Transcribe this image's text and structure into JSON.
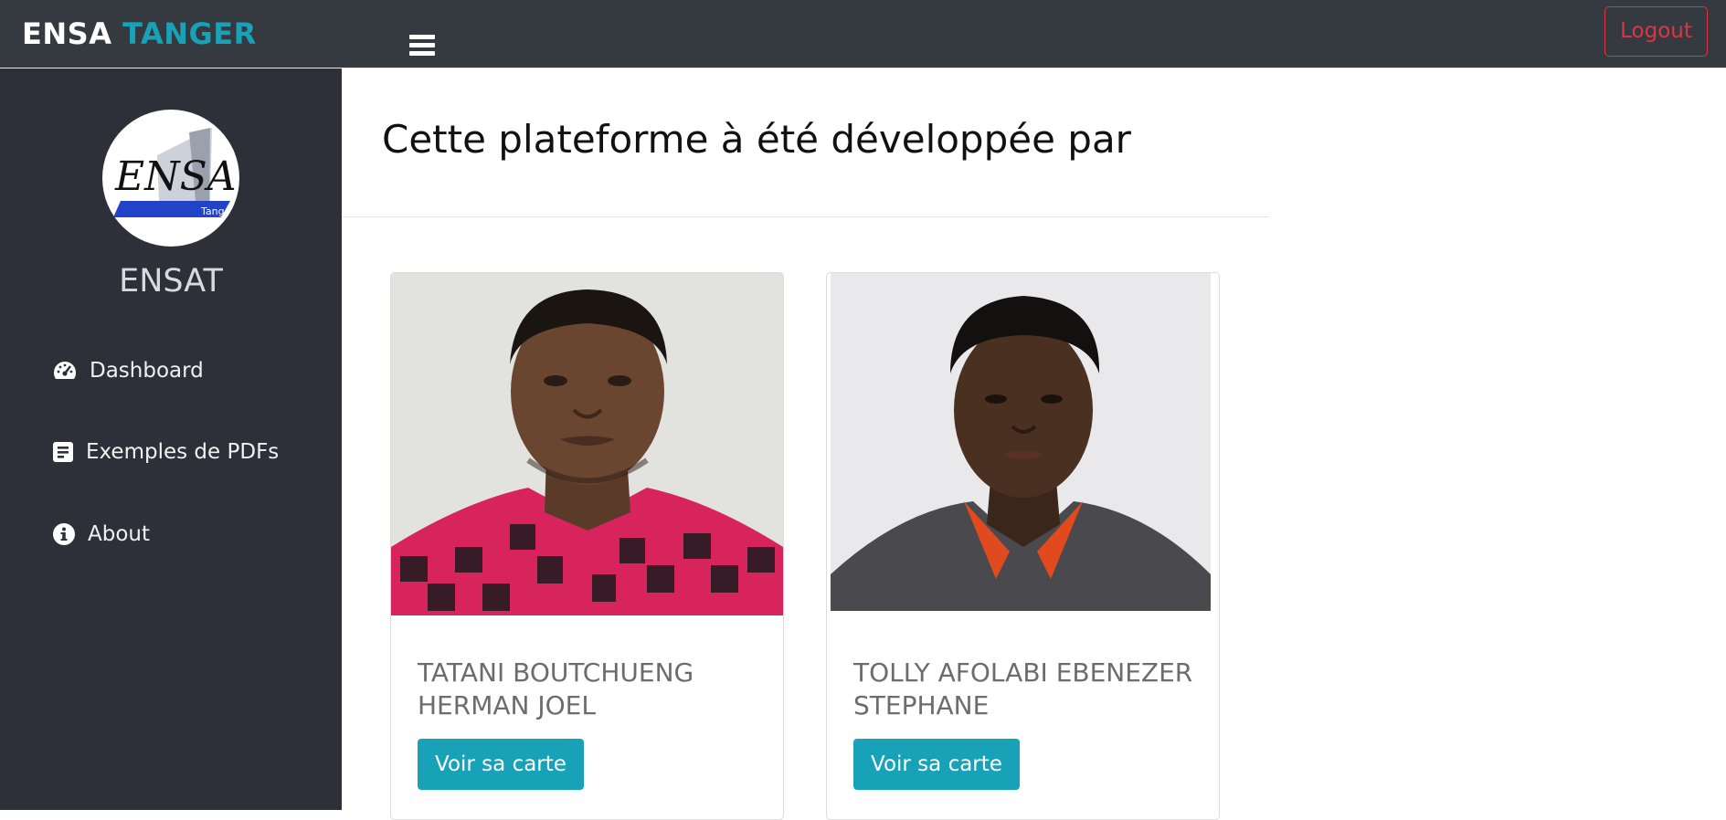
{
  "header": {
    "brand_part1": "ENSA",
    "brand_part2": "TANGER",
    "menu_icon": "hamburger-icon",
    "logout_label": "Logout"
  },
  "sidebar": {
    "logo_text": "ENSA",
    "logo_subtext": "Tanger",
    "title": "ENSAT",
    "items": [
      {
        "label": "Dashboard",
        "icon": "speedometer-icon"
      },
      {
        "label": "Exemples de PDFs",
        "icon": "document-icon"
      },
      {
        "label": "About",
        "icon": "info-icon"
      }
    ]
  },
  "main": {
    "title": "Cette plateforme à été développée par",
    "developers": [
      {
        "name": "TATANI BOUTCHUENG HERMAN JOEL",
        "button_label": "Voir sa carte"
      },
      {
        "name": "TOLLY AFOLABI EBENEZER STEPHANE",
        "button_label": "Voir sa carte"
      }
    ]
  },
  "colors": {
    "topbar": "#343a40",
    "sidebar": "#2d3038",
    "accent": "#17a2b8",
    "logout": "#dc3545"
  }
}
